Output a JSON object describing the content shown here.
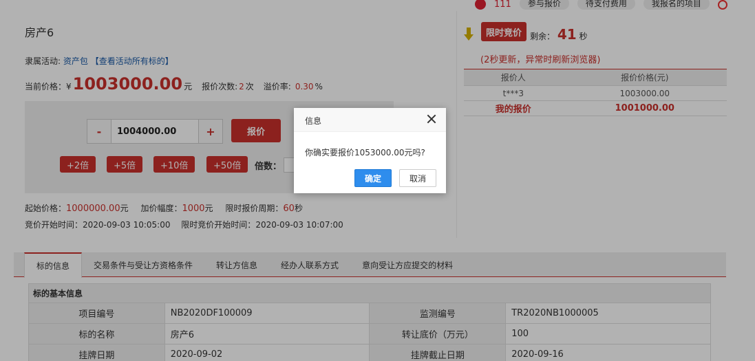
{
  "topbar": {
    "count": "111",
    "pills": [
      "参与报价",
      "待支付费用",
      "我报名的项目"
    ]
  },
  "property": {
    "title": "房产6",
    "activity_label": "隶属活动:",
    "activity_link": "资产包",
    "view_all_link": "【查看活动所有标的】",
    "current_price_label": "当前价格：¥",
    "current_price": "1003000.00",
    "yuan": "元",
    "bid_count_label": "报价次数:",
    "bid_count": "2",
    "times_unit": "次",
    "premium_label": "溢价率:",
    "premium": "0.30",
    "percent": "%"
  },
  "bid_box": {
    "minus": "-",
    "plus": "+",
    "bid_value": "1004000.00",
    "bid_button": "报价",
    "multipliers": [
      "+2倍",
      "+5倍",
      "+10倍",
      "+50倍"
    ],
    "multiple_label": "倍数："
  },
  "meta": {
    "start_price_label": "起始价格：",
    "start_price": "1000000.00",
    "yuan": "元",
    "increment_label": "加价幅度：",
    "increment": "1000",
    "period_label": "限时报价周期：",
    "period": "60",
    "sec": "秒",
    "start_time_label": "竞价开始时间：",
    "start_time": "2020-09-03 10:05:00",
    "limit_start_label": "限时竞价开始时间：",
    "limit_start": "2020-09-03 10:07:00"
  },
  "right": {
    "limit_badge": "限时竞价",
    "remain_label": "剩余：",
    "remain_secs": "41",
    "sec": "秒",
    "refresh_tip": "(2秒更新，异常时刷新浏览器)",
    "table_headers": [
      "报价人",
      "报价价格(元)"
    ],
    "rows": [
      {
        "bidder": "t***3",
        "price": "1003000.00"
      }
    ],
    "mine": {
      "bidder": "我的报价",
      "price": "1001000.00"
    }
  },
  "tabs": [
    "标的信息",
    "交易条件与受让方资格条件",
    "转让方信息",
    "经办人联系方式",
    "意向受让方应提交的材料"
  ],
  "info": {
    "section_title": "标的基本信息",
    "rows": [
      {
        "k1": "项目编号",
        "v1": "NB2020DF100009",
        "k2": "监测编号",
        "v2": "TR2020NB1000005"
      },
      {
        "k1": "标的名称",
        "v1": "房产6",
        "k2": "转让底价（万元）",
        "v2": "100"
      },
      {
        "k1": "挂牌日期",
        "v1": "2020-09-02",
        "k2": "挂牌截止日期",
        "v2": "2020-09-16"
      }
    ]
  },
  "dialog": {
    "title": "信息",
    "message": "你确实要报价1053000.00元吗?",
    "ok": "确定",
    "cancel": "取消"
  }
}
